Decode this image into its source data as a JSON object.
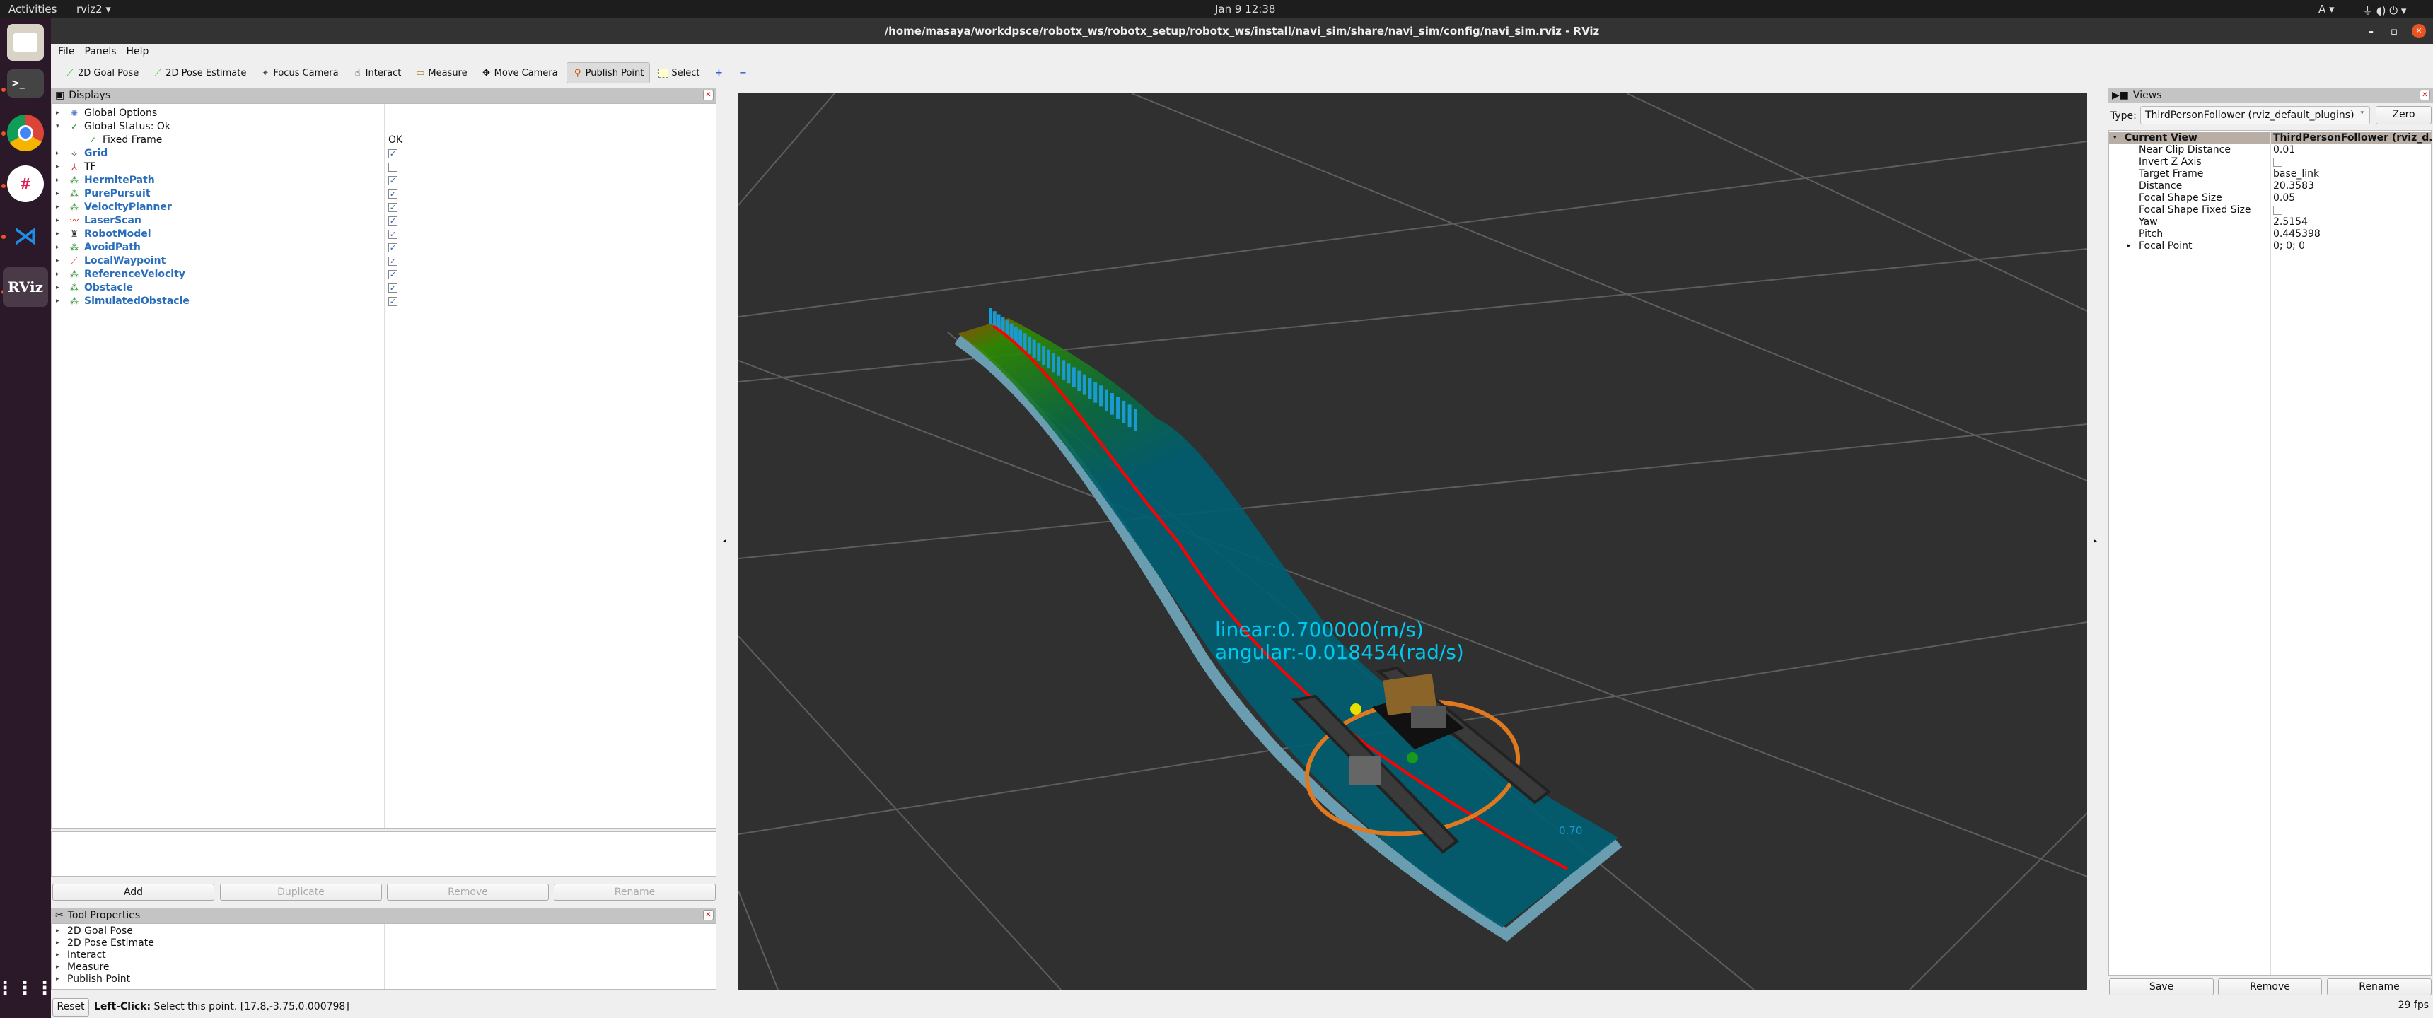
{
  "topbar": {
    "activities": "Activities",
    "app": "rviz2 ▾",
    "clock": "Jan 9  12:38",
    "tray": "A ▾"
  },
  "dock": {
    "items": [
      "files",
      "terminal",
      "chrome",
      "slack",
      "vscode",
      "rviz"
    ],
    "rviz_label": "RViz"
  },
  "window": {
    "title": "/home/masaya/workdpsce/robotx_ws/robotx_setup/robotx_ws/install/navi_sim/share/navi_sim/config/navi_sim.rviz - RViz",
    "minimize": "–",
    "maximize": "▫",
    "close": "✕"
  },
  "menu": [
    "File",
    "Panels",
    "Help"
  ],
  "toolbar": [
    {
      "label": "2D Goal Pose",
      "icon": "green-arrow-icon"
    },
    {
      "label": "2D Pose Estimate",
      "icon": "green-arrow-icon"
    },
    {
      "label": "Focus Camera",
      "icon": "crosshair-icon"
    },
    {
      "label": "Interact",
      "icon": "hand-icon"
    },
    {
      "label": "Measure",
      "icon": "ruler-icon"
    },
    {
      "label": "Move Camera",
      "icon": "move-icon"
    },
    {
      "label": "Publish Point",
      "icon": "map-pin-icon",
      "active": true
    },
    {
      "label": "Select",
      "icon": "select-box-icon"
    }
  ],
  "displays": {
    "title": "Displays",
    "items": [
      {
        "label": "Global Options",
        "icon": "gear-icon",
        "style": "plain",
        "arrow": "▸"
      },
      {
        "label": "Global Status: Ok",
        "icon": "check-icon",
        "style": "plain",
        "arrow": "▾"
      },
      {
        "label": "Fixed Frame",
        "icon": "check-icon",
        "style": "plain",
        "indent": true,
        "value": "OK"
      },
      {
        "label": "Grid",
        "icon": "grid-icon",
        "style": "blue",
        "arrow": "▸",
        "checked": true
      },
      {
        "label": "TF",
        "icon": "axes-icon",
        "style": "plain",
        "arrow": "▸",
        "checked": false
      },
      {
        "label": "HermitePath",
        "icon": "marker-icon",
        "style": "blue",
        "arrow": "▸",
        "checked": true
      },
      {
        "label": "PurePursuit",
        "icon": "marker-icon",
        "style": "blue",
        "arrow": "▸",
        "checked": true
      },
      {
        "label": "VelocityPlanner",
        "icon": "marker-icon",
        "style": "blue",
        "arrow": "▸",
        "checked": true
      },
      {
        "label": "LaserScan",
        "icon": "laser-icon",
        "style": "blue",
        "arrow": "▸",
        "checked": true
      },
      {
        "label": "RobotModel",
        "icon": "robot-icon",
        "style": "blue",
        "arrow": "▸",
        "checked": true
      },
      {
        "label": "AvoidPath",
        "icon": "marker-icon",
        "style": "blue",
        "arrow": "▸",
        "checked": true
      },
      {
        "label": "LocalWaypoint",
        "icon": "pose-arrow-icon",
        "style": "blue",
        "arrow": "▸",
        "checked": true
      },
      {
        "label": "ReferenceVelocity",
        "icon": "marker-icon",
        "style": "blue",
        "arrow": "▸",
        "checked": true
      },
      {
        "label": "Obstacle",
        "icon": "marker-icon",
        "style": "blue",
        "arrow": "▸",
        "checked": true
      },
      {
        "label": "SimulatedObstacle",
        "icon": "marker-icon",
        "style": "blue",
        "arrow": "▸",
        "checked": true
      }
    ],
    "buttons": {
      "add": "Add",
      "duplicate": "Duplicate",
      "remove": "Remove",
      "rename": "Rename"
    }
  },
  "tool_properties": {
    "title": "Tool Properties",
    "items": [
      "2D Goal Pose",
      "2D Pose Estimate",
      "Interact",
      "Measure",
      "Publish Point"
    ]
  },
  "views": {
    "title": "Views",
    "type_label": "Type:",
    "type_value": "ThirdPersonFollower (rviz_default_plugins)",
    "zero": "Zero",
    "header": {
      "name": "Current View",
      "value": "ThirdPersonFollower (rviz_d..."
    },
    "props": [
      {
        "name": "Near Clip Distance",
        "value": "0.01"
      },
      {
        "name": "Invert Z Axis",
        "checkbox": true
      },
      {
        "name": "Target Frame",
        "value": "base_link"
      },
      {
        "name": "Distance",
        "value": "20.3583"
      },
      {
        "name": "Focal Shape Size",
        "value": "0.05"
      },
      {
        "name": "Focal Shape Fixed Size",
        "checkbox": true
      },
      {
        "name": "Yaw",
        "value": "2.5154"
      },
      {
        "name": "Pitch",
        "value": "0.445398"
      },
      {
        "name": "Focal Point",
        "value": "0; 0; 0",
        "arrow": "▸"
      }
    ],
    "buttons": {
      "save": "Save",
      "remove": "Remove",
      "rename": "Rename"
    }
  },
  "scene": {
    "linear": "linear:0.700000(m/s)",
    "angular": "angular:-0.018454(rad/s)",
    "velocity_label": "0.70",
    "colors": {
      "path": "#005d70",
      "edge": "#6a9db0",
      "line": "#ff0000",
      "ring": "#e07820",
      "text": "#00c8ee"
    }
  },
  "status": {
    "reset": "Reset",
    "hint_bold": "Left-Click:",
    "hint": " Select this point. [17.8,-3.75,0.000798]",
    "fps": "29 fps"
  }
}
